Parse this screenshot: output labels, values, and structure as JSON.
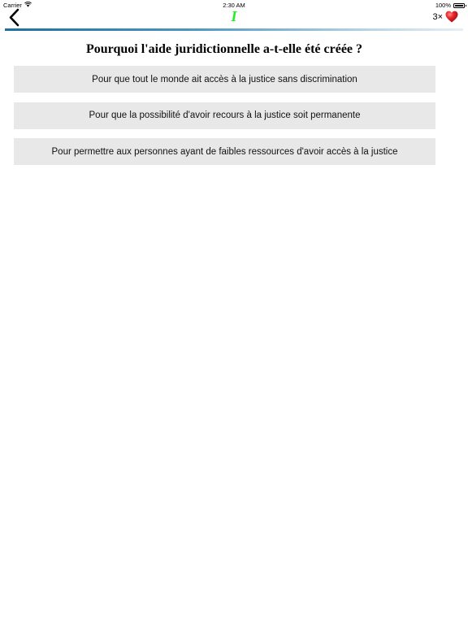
{
  "status_bar": {
    "carrier": "Carrier",
    "time": "2:30 AM",
    "battery": "100%"
  },
  "nav": {
    "back_icon": "chevron-left-icon",
    "logo": "I",
    "lives_count": "3×",
    "heart_icon": "heart-icon",
    "logo_color": "#22ee22",
    "heart_color": "#e8262b",
    "divider_color": "#1f6f9e"
  },
  "quiz": {
    "question": "Pourquoi l'aide juridictionnelle a-t-elle été créée ?",
    "answers": [
      "Pour que tout le monde ait accès à la justice sans discrimination",
      "Pour que la possibilité d'avoir recours à la justice soit permanente",
      "Pour permettre aux personnes ayant de faibles ressources d'avoir accès à la justice"
    ]
  }
}
